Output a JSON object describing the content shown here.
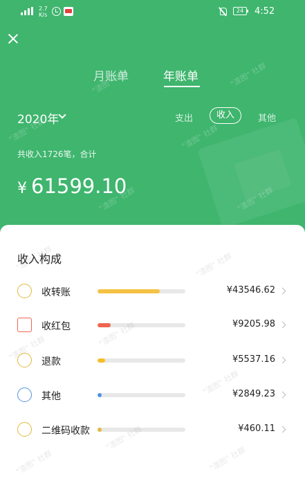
{
  "status_bar": {
    "signal_label": "4G",
    "net_speed_value": "2.7",
    "net_speed_unit": "K/s",
    "battery": "24",
    "time": "4:52"
  },
  "tabs": {
    "month": "月账单",
    "year": "年账单",
    "active": "year"
  },
  "year_selector": {
    "value": "2020年"
  },
  "filters": {
    "expense": "支出",
    "income": "收入",
    "other": "其他",
    "active": "income"
  },
  "summary": {
    "text": "共收入1726笔，合计"
  },
  "total": {
    "currency": "¥",
    "amount": "61599.10"
  },
  "breakdown": {
    "title": "收入构成",
    "items": [
      {
        "label": "收转账",
        "amount": "¥43546.62",
        "share": 0.707,
        "color": "#f6c244",
        "icon": "transfer-icon"
      },
      {
        "label": "收红包",
        "amount": "¥9205.98",
        "share": 0.149,
        "color": "#ed6650",
        "icon": "red-packet-icon"
      },
      {
        "label": "退款",
        "amount": "¥5537.16",
        "share": 0.09,
        "color": "#f3c027",
        "icon": "refund-icon"
      },
      {
        "label": "其他",
        "amount": "¥2849.23",
        "share": 0.046,
        "color": "#4d94de",
        "icon": "other-icon"
      },
      {
        "label": "二维码收款",
        "amount": "¥460.11",
        "share": 0.0075,
        "color": "#e0b93c",
        "icon": "qr-payment-icon"
      }
    ]
  },
  "watermark": {
    "text": "\"渣图\" 社群"
  },
  "colors": {
    "header": "#3fb56e",
    "panel": "#ffffff"
  }
}
